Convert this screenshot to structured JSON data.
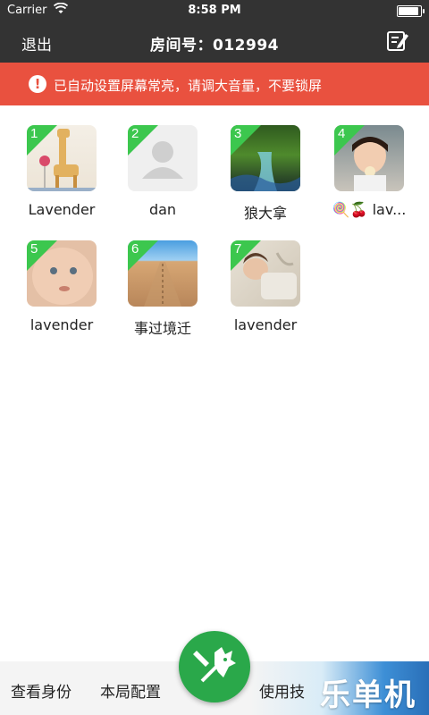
{
  "status_bar": {
    "carrier": "Carrier",
    "time": "8:58 PM"
  },
  "nav": {
    "back_label": "退出",
    "title_label": "房间号：",
    "room_number": "012994",
    "edit_icon": "edit-note-icon"
  },
  "banner": {
    "alert_symbol": "!",
    "message": "已自动设置屏幕常亮，请调大音量，不要锁屏",
    "color": "#e9513f"
  },
  "players": [
    {
      "number": "1",
      "name": "Lavender"
    },
    {
      "number": "2",
      "name": "dan"
    },
    {
      "number": "3",
      "name": "狼大拿"
    },
    {
      "number": "4",
      "name": "🍭🍒 lav..."
    },
    {
      "number": "5",
      "name": "lavender"
    },
    {
      "number": "6",
      "name": "事过境迁"
    },
    {
      "number": "7",
      "name": "lavender"
    }
  ],
  "bottom": {
    "view_identity": "查看身份",
    "game_config": "本局配置",
    "usage_tips": "使用技",
    "watermark": "乐单机"
  },
  "colors": {
    "topbar": "#333333",
    "badge": "#3cc74e",
    "fab": "#2aa84a"
  }
}
